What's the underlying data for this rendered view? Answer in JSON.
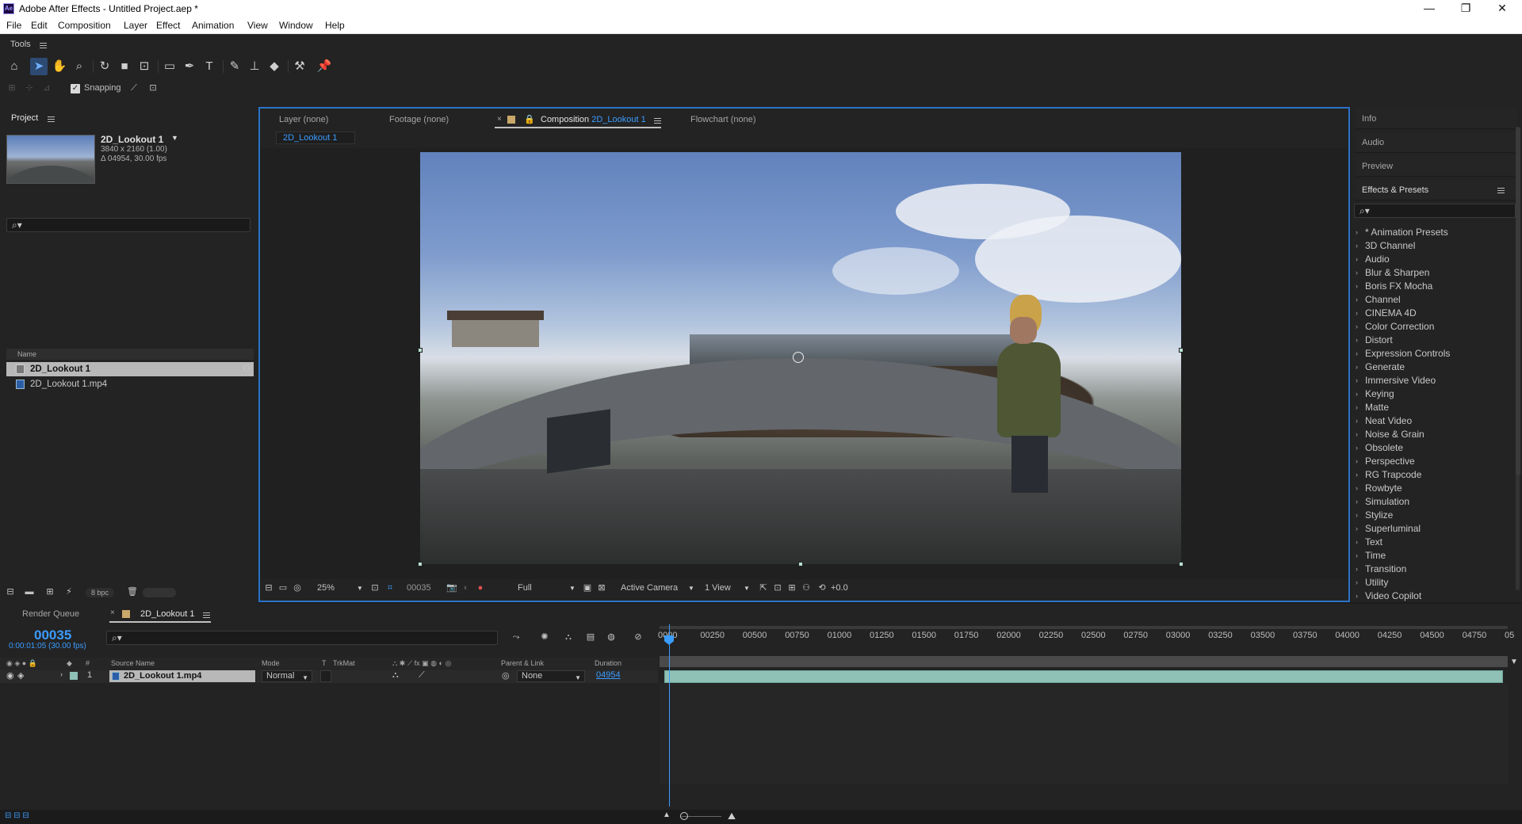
{
  "window": {
    "title": "Adobe After Effects - Untitled Project.aep *",
    "app_icon_text": "Ae",
    "controls": [
      "—",
      "❐",
      "✕"
    ]
  },
  "menu": [
    "File",
    "Edit",
    "Composition",
    "Layer",
    "Effect",
    "Animation",
    "View",
    "Window",
    "Help"
  ],
  "tools": {
    "label": "Tools",
    "snapping_label": "Snapping",
    "snapping_checked": true
  },
  "project": {
    "tab_label": "Project",
    "comp_name": "2D_Lookout 1",
    "comp_res": "3840 x 2160 (1.00)",
    "comp_dur": "Δ 04954, 30.00 fps",
    "name_header": "Name",
    "items": [
      {
        "name": "2D_Lookout 1",
        "type": "composition",
        "selected": true
      },
      {
        "name": "2D_Lookout 1.mp4",
        "type": "footage",
        "selected": false
      }
    ],
    "bpc": "8 bpc"
  },
  "viewer": {
    "tabs": [
      {
        "label": "Layer (none)"
      },
      {
        "label": "Footage (none)"
      },
      {
        "prefix": "Composition",
        "name": "2D_Lookout 1"
      },
      {
        "label": "Flowchart (none)"
      }
    ],
    "subtab": "2D_Lookout 1",
    "zoom": "25%",
    "timecode": "00035",
    "resolution": "Full",
    "camera": "Active Camera",
    "views": "1 View",
    "exposure": "+0.0"
  },
  "right_panel": {
    "tabs": [
      "Info",
      "Audio",
      "Preview"
    ],
    "effects_title": "Effects & Presets",
    "effects": [
      "* Animation Presets",
      "3D Channel",
      "Audio",
      "Blur & Sharpen",
      "Boris FX Mocha",
      "Channel",
      "CINEMA 4D",
      "Color Correction",
      "Distort",
      "Expression Controls",
      "Generate",
      "Immersive Video",
      "Keying",
      "Matte",
      "Neat Video",
      "Noise & Grain",
      "Obsolete",
      "Perspective",
      "RG Trapcode",
      "Rowbyte",
      "Simulation",
      "Stylize",
      "Superluminal",
      "Text",
      "Time",
      "Transition",
      "Utility",
      "Video Copilot"
    ]
  },
  "timeline": {
    "tabs": [
      "Render Queue",
      "2D_Lookout 1"
    ],
    "timecode": "00035",
    "subcode": "0:00:01:05 (30.00 fps)",
    "headers": {
      "source_name": "Source Name",
      "mode": "Mode",
      "t": "T",
      "trkmat": "TrkMat",
      "parent": "Parent & Link",
      "duration": "Duration"
    },
    "layer": {
      "index": "1",
      "name": "2D_Lookout 1.mp4",
      "mode": "Normal",
      "parent": "None",
      "duration": "04954"
    },
    "ruler": [
      "0000",
      "00250",
      "00500",
      "00750",
      "01000",
      "01250",
      "01500",
      "01750",
      "02000",
      "02250",
      "02500",
      "02750",
      "03000",
      "03250",
      "03500",
      "03750",
      "04000",
      "04250",
      "04500",
      "04750",
      "05"
    ]
  }
}
